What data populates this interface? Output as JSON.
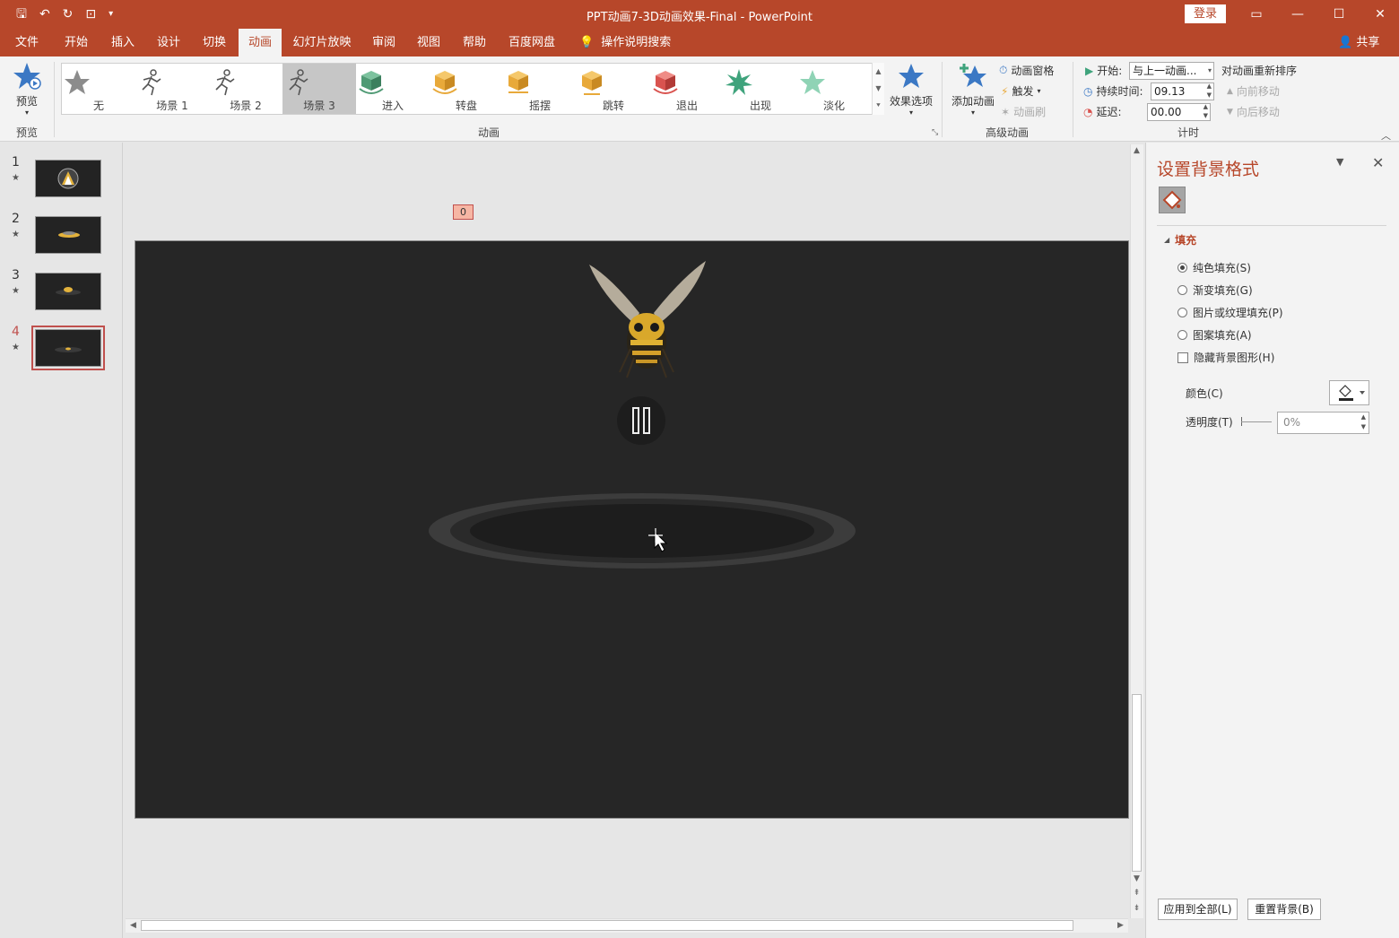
{
  "app": {
    "title": "PPT动画7-3D动画效果-Final  -  PowerPoint",
    "login": "登录",
    "share": "共享",
    "tell_me": "操作说明搜索"
  },
  "tabs": [
    "文件",
    "开始",
    "插入",
    "设计",
    "切换",
    "动画",
    "幻灯片放映",
    "审阅",
    "视图",
    "帮助",
    "百度网盘"
  ],
  "active_tab": "动画",
  "ribbon": {
    "preview": {
      "label": "预览",
      "group": "预览"
    },
    "animation_group": "动画",
    "gallery": [
      {
        "label": "无",
        "icon": "star-gray-icon",
        "color": "#8c8c8c"
      },
      {
        "label": "场景 1",
        "icon": "runner-icon",
        "color": "#555555"
      },
      {
        "label": "场景 2",
        "icon": "runner-icon",
        "color": "#555555"
      },
      {
        "label": "场景 3",
        "icon": "runner-icon",
        "color": "#555555"
      },
      {
        "label": "进入",
        "icon": "cube-enter-icon",
        "color": "#5aa37c"
      },
      {
        "label": "转盘",
        "icon": "cube-turntable-icon",
        "color": "#e8a93a"
      },
      {
        "label": "摇摆",
        "icon": "cube-swing-icon",
        "color": "#e8a93a"
      },
      {
        "label": "跳转",
        "icon": "cube-jump-icon",
        "color": "#e8a93a"
      },
      {
        "label": "退出",
        "icon": "cube-exit-icon",
        "color": "#d9534f"
      },
      {
        "label": "出现",
        "icon": "star-burst-icon",
        "color": "#3fa37c"
      },
      {
        "label": "淡化",
        "icon": "star-fade-icon",
        "color": "#62c09a"
      }
    ],
    "selected_gallery": "场景 3",
    "effect_options": "效果选项",
    "advanced_group": "高级动画",
    "add_animation": "添加动画",
    "animation_pane": "动画窗格",
    "trigger": "触发",
    "animation_painter": "动画刷",
    "timing_group": "计时",
    "start_label": "开始:",
    "start_value": "与上一动画...",
    "duration_label": "持续时间:",
    "duration_value": "09.13",
    "delay_label": "延迟:",
    "delay_value": "00.00",
    "reorder_title": "对动画重新排序",
    "move_earlier": "向前移动",
    "move_later": "向后移动"
  },
  "slides": [
    {
      "num": "1",
      "star": "★"
    },
    {
      "num": "2",
      "star": "★"
    },
    {
      "num": "3",
      "star": "★"
    },
    {
      "num": "4",
      "star": "★"
    }
  ],
  "selected_slide": "4",
  "canvas": {
    "animation_tag": "0",
    "background_color": "#262626"
  },
  "format_pane": {
    "title": "设置背景格式",
    "section": "填充",
    "options": [
      "纯色填充(S)",
      "渐变填充(G)",
      "图片或纹理填充(P)",
      "图案填充(A)"
    ],
    "selected_option": "纯色填充(S)",
    "hide_background": "隐藏背景图形(H)",
    "color_label": "颜色(C)",
    "transparency_label": "透明度(T)",
    "transparency_value": "0%",
    "apply_all": "应用到全部(L)",
    "reset_background": "重置背景(B)"
  },
  "colors": {
    "accent": "#b7472a",
    "ribbon_bg": "#f3f3f3"
  }
}
